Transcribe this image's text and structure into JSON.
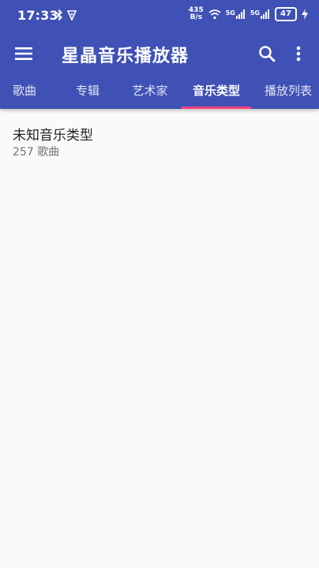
{
  "status": {
    "time": "17:33",
    "net_speed_value": "435",
    "net_speed_unit": "B/s",
    "sim1": "5G",
    "sim2": "5G",
    "battery": "47"
  },
  "toolbar": {
    "title": "星晶音乐播放器"
  },
  "tabs": [
    {
      "label": "歌曲"
    },
    {
      "label": "专辑"
    },
    {
      "label": "艺术家"
    },
    {
      "label": "音乐类型",
      "active": true
    },
    {
      "label": "播放列表"
    }
  ],
  "genres": [
    {
      "name": "未知音乐类型",
      "count": "257 歌曲"
    }
  ],
  "colors": {
    "primary": "#3f51b5",
    "accent": "#ff4081",
    "background": "#fafafa"
  }
}
